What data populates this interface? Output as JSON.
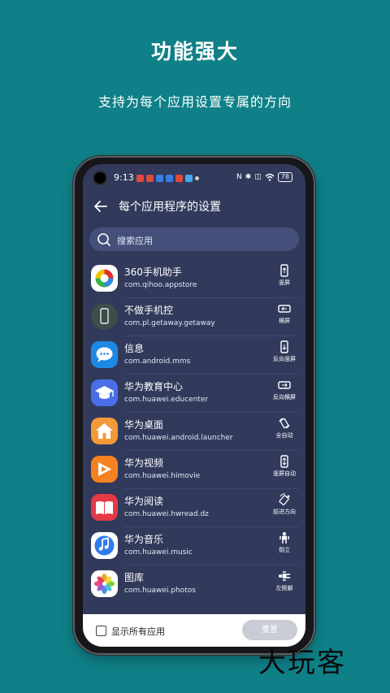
{
  "hero": {
    "title": "功能强大",
    "subtitle": "支持为每个应用设置专属的方向"
  },
  "status": {
    "time": "9:13",
    "battery": "78"
  },
  "appbar": {
    "title": "每个应用程序的设置"
  },
  "search": {
    "placeholder": "搜索应用"
  },
  "apps": [
    {
      "name": "360手机助手",
      "package": "com.qihoo.appstore",
      "mode": "竖屏",
      "icon": "360-appstore-icon",
      "mode_icon": "portrait-icon"
    },
    {
      "name": "不做手机控",
      "package": "com.pl.getaway.getaway",
      "mode": "横屏",
      "icon": "phone-control-icon",
      "mode_icon": "landscape-icon"
    },
    {
      "name": "信息",
      "package": "com.android.mms",
      "mode": "反向竖屏",
      "icon": "messages-icon",
      "mode_icon": "reverse-portrait-icon"
    },
    {
      "name": "华为教育中心",
      "package": "com.huawei.educenter",
      "mode": "反向横屏",
      "icon": "education-icon",
      "mode_icon": "reverse-landscape-icon"
    },
    {
      "name": "华为桌面",
      "package": "com.huawei.android.launcher",
      "mode": "全自动",
      "icon": "launcher-icon",
      "mode_icon": "full-auto-icon"
    },
    {
      "name": "华为视频",
      "package": "com.huawei.himovie",
      "mode": "竖屏自动",
      "icon": "video-icon",
      "mode_icon": "portrait-auto-icon"
    },
    {
      "name": "华为阅读",
      "package": "com.huawei.hwread.dz",
      "mode": "前进方向",
      "icon": "reader-icon",
      "mode_icon": "forward-direction-icon"
    },
    {
      "name": "华为音乐",
      "package": "com.huawei.music",
      "mode": "倒立",
      "icon": "music-icon",
      "mode_icon": "upside-down-icon"
    },
    {
      "name": "图库",
      "package": "com.huawei.photos",
      "mode": "左侧躺",
      "icon": "gallery-icon",
      "mode_icon": "lying-left-icon"
    }
  ],
  "bottom": {
    "show_all_label": "显示所有应用",
    "reset_label": "重置"
  },
  "watermark": "大玩客",
  "colors": {
    "background": "#0f8088",
    "screen": "#323a5c",
    "search": "#44507a"
  }
}
